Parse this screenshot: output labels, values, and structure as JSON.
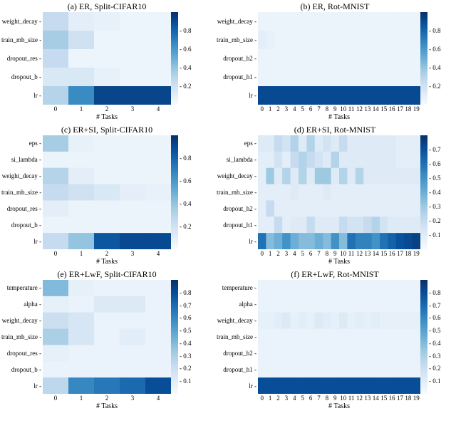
{
  "chart_data": [
    {
      "id": "a",
      "type": "heatmap",
      "title": "(a)  ER, Split-CIFAR10",
      "xlabel": "# Tasks",
      "x": [
        0,
        1,
        2,
        3,
        4
      ],
      "y": [
        "weight_decay",
        "train_mb_size",
        "dropout_res",
        "dropout_b",
        "lr"
      ],
      "z": [
        [
          0.25,
          0.1,
          0.08,
          0.05,
          0.05
        ],
        [
          0.35,
          0.2,
          0.05,
          0.05,
          0.05
        ],
        [
          0.25,
          0.05,
          0.05,
          0.05,
          0.05
        ],
        [
          0.15,
          0.15,
          0.08,
          0.05,
          0.05
        ],
        [
          0.3,
          0.65,
          0.92,
          0.92,
          0.92
        ]
      ],
      "colorbar": {
        "min": 0.0,
        "max": 1.0,
        "ticks": [
          0.2,
          0.4,
          0.6,
          0.8
        ]
      }
    },
    {
      "id": "b",
      "type": "heatmap",
      "title": "(b)  ER, Rot-MNIST",
      "xlabel": "# Tasks",
      "x": [
        0,
        1,
        2,
        3,
        4,
        5,
        6,
        7,
        8,
        9,
        10,
        11,
        12,
        13,
        14,
        15,
        16,
        17,
        18,
        19
      ],
      "y": [
        "weight_decay",
        "train_mb_size",
        "dropout_h2",
        "dropout_h1",
        "lr"
      ],
      "z": [
        [
          0.06,
          0.06,
          0.06,
          0.06,
          0.06,
          0.06,
          0.06,
          0.06,
          0.06,
          0.06,
          0.06,
          0.06,
          0.06,
          0.06,
          0.06,
          0.06,
          0.06,
          0.06,
          0.06,
          0.06
        ],
        [
          0.1,
          0.08,
          0.06,
          0.06,
          0.06,
          0.06,
          0.06,
          0.06,
          0.06,
          0.06,
          0.06,
          0.06,
          0.06,
          0.06,
          0.06,
          0.06,
          0.06,
          0.06,
          0.06,
          0.06
        ],
        [
          0.06,
          0.06,
          0.06,
          0.06,
          0.06,
          0.06,
          0.06,
          0.06,
          0.06,
          0.06,
          0.06,
          0.06,
          0.06,
          0.06,
          0.06,
          0.06,
          0.06,
          0.06,
          0.06,
          0.06
        ],
        [
          0.06,
          0.06,
          0.06,
          0.06,
          0.06,
          0.06,
          0.06,
          0.06,
          0.06,
          0.06,
          0.06,
          0.06,
          0.06,
          0.06,
          0.06,
          0.06,
          0.06,
          0.06,
          0.06,
          0.06
        ],
        [
          0.9,
          0.9,
          0.9,
          0.9,
          0.9,
          0.9,
          0.9,
          0.9,
          0.9,
          0.9,
          0.9,
          0.9,
          0.9,
          0.9,
          0.9,
          0.9,
          0.9,
          0.9,
          0.9,
          0.9
        ]
      ],
      "colorbar": {
        "min": 0.0,
        "max": 1.0,
        "ticks": [
          0.2,
          0.4,
          0.6,
          0.8
        ]
      }
    },
    {
      "id": "c",
      "type": "heatmap",
      "title": "(c)  ER+SI, Split-CIFAR10",
      "xlabel": "# Tasks",
      "x": [
        0,
        1,
        2,
        3,
        4
      ],
      "y": [
        "eps",
        "si_lambda",
        "weight_decay",
        "train_mb_size",
        "dropout_res",
        "dropout_b",
        "lr"
      ],
      "z": [
        [
          0.35,
          0.08,
          0.06,
          0.06,
          0.06
        ],
        [
          0.06,
          0.06,
          0.06,
          0.06,
          0.06
        ],
        [
          0.3,
          0.1,
          0.06,
          0.06,
          0.06
        ],
        [
          0.25,
          0.2,
          0.15,
          0.1,
          0.08
        ],
        [
          0.1,
          0.06,
          0.06,
          0.06,
          0.06
        ],
        [
          0.06,
          0.06,
          0.06,
          0.06,
          0.06
        ],
        [
          0.25,
          0.4,
          0.85,
          0.9,
          0.9
        ]
      ],
      "colorbar": {
        "min": 0.0,
        "max": 1.0,
        "ticks": [
          0.2,
          0.4,
          0.6,
          0.8
        ]
      }
    },
    {
      "id": "d",
      "type": "heatmap",
      "title": "(d)  ER+SI, Rot-MNIST",
      "xlabel": "# Tasks",
      "x": [
        0,
        1,
        2,
        3,
        4,
        5,
        6,
        7,
        8,
        9,
        10,
        11,
        12,
        13,
        14,
        15,
        16,
        17,
        18,
        19
      ],
      "y": [
        "eps",
        "si_lambda",
        "weight_decay",
        "train_mb_size",
        "dropout_h2",
        "dropout_h1",
        "lr"
      ],
      "z": [
        [
          0.1,
          0.1,
          0.2,
          0.15,
          0.25,
          0.1,
          0.25,
          0.1,
          0.15,
          0.1,
          0.2,
          0.1,
          0.1,
          0.1,
          0.1,
          0.1,
          0.1,
          0.08,
          0.08,
          0.08
        ],
        [
          0.08,
          0.08,
          0.15,
          0.08,
          0.2,
          0.25,
          0.2,
          0.15,
          0.1,
          0.25,
          0.1,
          0.1,
          0.1,
          0.1,
          0.1,
          0.1,
          0.1,
          0.08,
          0.08,
          0.08
        ],
        [
          0.08,
          0.3,
          0.1,
          0.25,
          0.1,
          0.25,
          0.1,
          0.3,
          0.3,
          0.1,
          0.25,
          0.1,
          0.25,
          0.1,
          0.1,
          0.1,
          0.1,
          0.1,
          0.1,
          0.1
        ],
        [
          0.08,
          0.08,
          0.08,
          0.08,
          0.1,
          0.08,
          0.08,
          0.08,
          0.1,
          0.08,
          0.08,
          0.08,
          0.08,
          0.08,
          0.08,
          0.08,
          0.08,
          0.08,
          0.08,
          0.08
        ],
        [
          0.08,
          0.2,
          0.08,
          0.08,
          0.08,
          0.08,
          0.08,
          0.08,
          0.08,
          0.08,
          0.08,
          0.08,
          0.08,
          0.08,
          0.08,
          0.08,
          0.08,
          0.08,
          0.08,
          0.08
        ],
        [
          0.08,
          0.08,
          0.2,
          0.08,
          0.1,
          0.1,
          0.2,
          0.1,
          0.1,
          0.1,
          0.2,
          0.15,
          0.15,
          0.2,
          0.25,
          0.15,
          0.1,
          0.1,
          0.1,
          0.1
        ],
        [
          0.6,
          0.35,
          0.4,
          0.5,
          0.4,
          0.35,
          0.35,
          0.4,
          0.35,
          0.5,
          0.35,
          0.6,
          0.55,
          0.55,
          0.5,
          0.6,
          0.65,
          0.7,
          0.72,
          0.75
        ]
      ],
      "colorbar": {
        "min": 0.0,
        "max": 0.8,
        "ticks": [
          0.1,
          0.2,
          0.3,
          0.4,
          0.5,
          0.6,
          0.7
        ]
      }
    },
    {
      "id": "e",
      "type": "heatmap",
      "title": "(e)  ER+LwF, Split-CIFAR10",
      "xlabel": "# Tasks",
      "x": [
        0,
        1,
        2,
        3,
        4
      ],
      "y": [
        "temperature",
        "alpha",
        "weight_decay",
        "train_mb_size",
        "dropout_res",
        "dropout_b",
        "lr"
      ],
      "z": [
        [
          0.4,
          0.08,
          0.06,
          0.06,
          0.06
        ],
        [
          0.08,
          0.06,
          0.12,
          0.12,
          0.06
        ],
        [
          0.2,
          0.15,
          0.06,
          0.06,
          0.06
        ],
        [
          0.3,
          0.15,
          0.06,
          0.1,
          0.06
        ],
        [
          0.08,
          0.06,
          0.06,
          0.06,
          0.06
        ],
        [
          0.06,
          0.06,
          0.06,
          0.06,
          0.06
        ],
        [
          0.25,
          0.6,
          0.65,
          0.7,
          0.8
        ]
      ],
      "colorbar": {
        "min": 0.0,
        "max": 0.9,
        "ticks": [
          0.1,
          0.2,
          0.3,
          0.4,
          0.5,
          0.6,
          0.7,
          0.8
        ]
      }
    },
    {
      "id": "f",
      "type": "heatmap",
      "title": "(f)  ER+LwF, Rot-MNIST",
      "xlabel": "# Tasks",
      "x": [
        0,
        1,
        2,
        3,
        4,
        5,
        6,
        7,
        8,
        9,
        10,
        11,
        12,
        13,
        14,
        15,
        16,
        17,
        18,
        19
      ],
      "y": [
        "temperature",
        "alpha",
        "weight_decay",
        "train_mb_size",
        "dropout_h2",
        "dropout_h1",
        "lr"
      ],
      "z": [
        [
          0.06,
          0.06,
          0.06,
          0.06,
          0.06,
          0.06,
          0.06,
          0.06,
          0.06,
          0.06,
          0.06,
          0.06,
          0.06,
          0.06,
          0.06,
          0.06,
          0.06,
          0.06,
          0.06,
          0.06
        ],
        [
          0.06,
          0.06,
          0.06,
          0.06,
          0.06,
          0.06,
          0.06,
          0.06,
          0.06,
          0.06,
          0.06,
          0.06,
          0.06,
          0.06,
          0.06,
          0.06,
          0.06,
          0.06,
          0.06,
          0.06
        ],
        [
          0.08,
          0.08,
          0.1,
          0.12,
          0.08,
          0.1,
          0.08,
          0.12,
          0.1,
          0.08,
          0.12,
          0.08,
          0.1,
          0.08,
          0.1,
          0.08,
          0.08,
          0.08,
          0.08,
          0.08
        ],
        [
          0.06,
          0.06,
          0.06,
          0.06,
          0.06,
          0.06,
          0.06,
          0.06,
          0.06,
          0.06,
          0.06,
          0.06,
          0.06,
          0.06,
          0.06,
          0.06,
          0.06,
          0.06,
          0.06,
          0.06
        ],
        [
          0.06,
          0.06,
          0.06,
          0.06,
          0.06,
          0.06,
          0.06,
          0.06,
          0.06,
          0.06,
          0.06,
          0.06,
          0.06,
          0.06,
          0.06,
          0.06,
          0.06,
          0.06,
          0.06,
          0.06
        ],
        [
          0.06,
          0.06,
          0.06,
          0.06,
          0.06,
          0.06,
          0.06,
          0.06,
          0.06,
          0.06,
          0.06,
          0.06,
          0.06,
          0.06,
          0.06,
          0.06,
          0.06,
          0.06,
          0.06,
          0.06
        ],
        [
          0.8,
          0.8,
          0.8,
          0.8,
          0.8,
          0.8,
          0.8,
          0.8,
          0.8,
          0.8,
          0.8,
          0.8,
          0.8,
          0.8,
          0.8,
          0.8,
          0.8,
          0.8,
          0.8,
          0.8
        ]
      ],
      "colorbar": {
        "min": 0.0,
        "max": 0.9,
        "ticks": [
          0.1,
          0.2,
          0.3,
          0.4,
          0.5,
          0.6,
          0.7,
          0.8
        ]
      }
    }
  ]
}
